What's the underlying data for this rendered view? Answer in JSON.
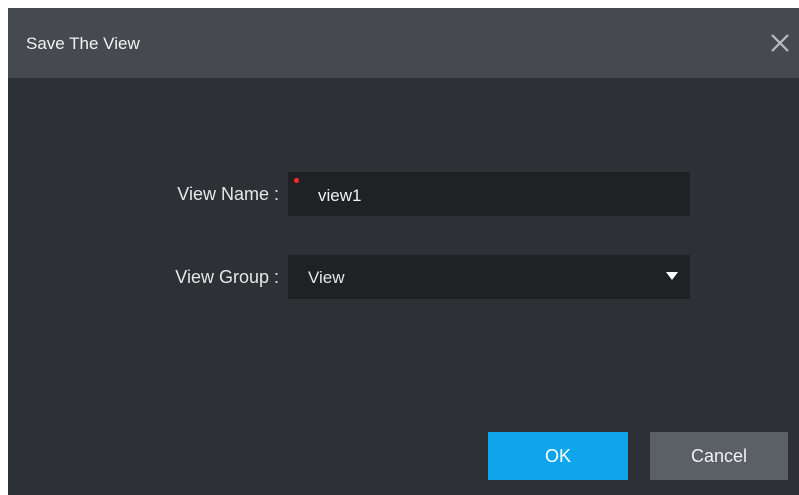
{
  "dialog": {
    "title": "Save The View",
    "close_icon": "close-icon",
    "fields": {
      "view_name": {
        "label": "View Name :",
        "value": "view1",
        "required": true
      },
      "view_group": {
        "label": "View Group :",
        "selected": "View",
        "dropdown_icon": "triangle-down-icon"
      }
    },
    "buttons": {
      "ok": "OK",
      "cancel": "Cancel"
    }
  },
  "colors": {
    "titlebar": "#464a50",
    "body": "#2d3035",
    "field_bg": "#1f2125",
    "required": "#ff2a2a",
    "ok_button": "#0ea5ec",
    "cancel_button": "#5b5f66"
  }
}
